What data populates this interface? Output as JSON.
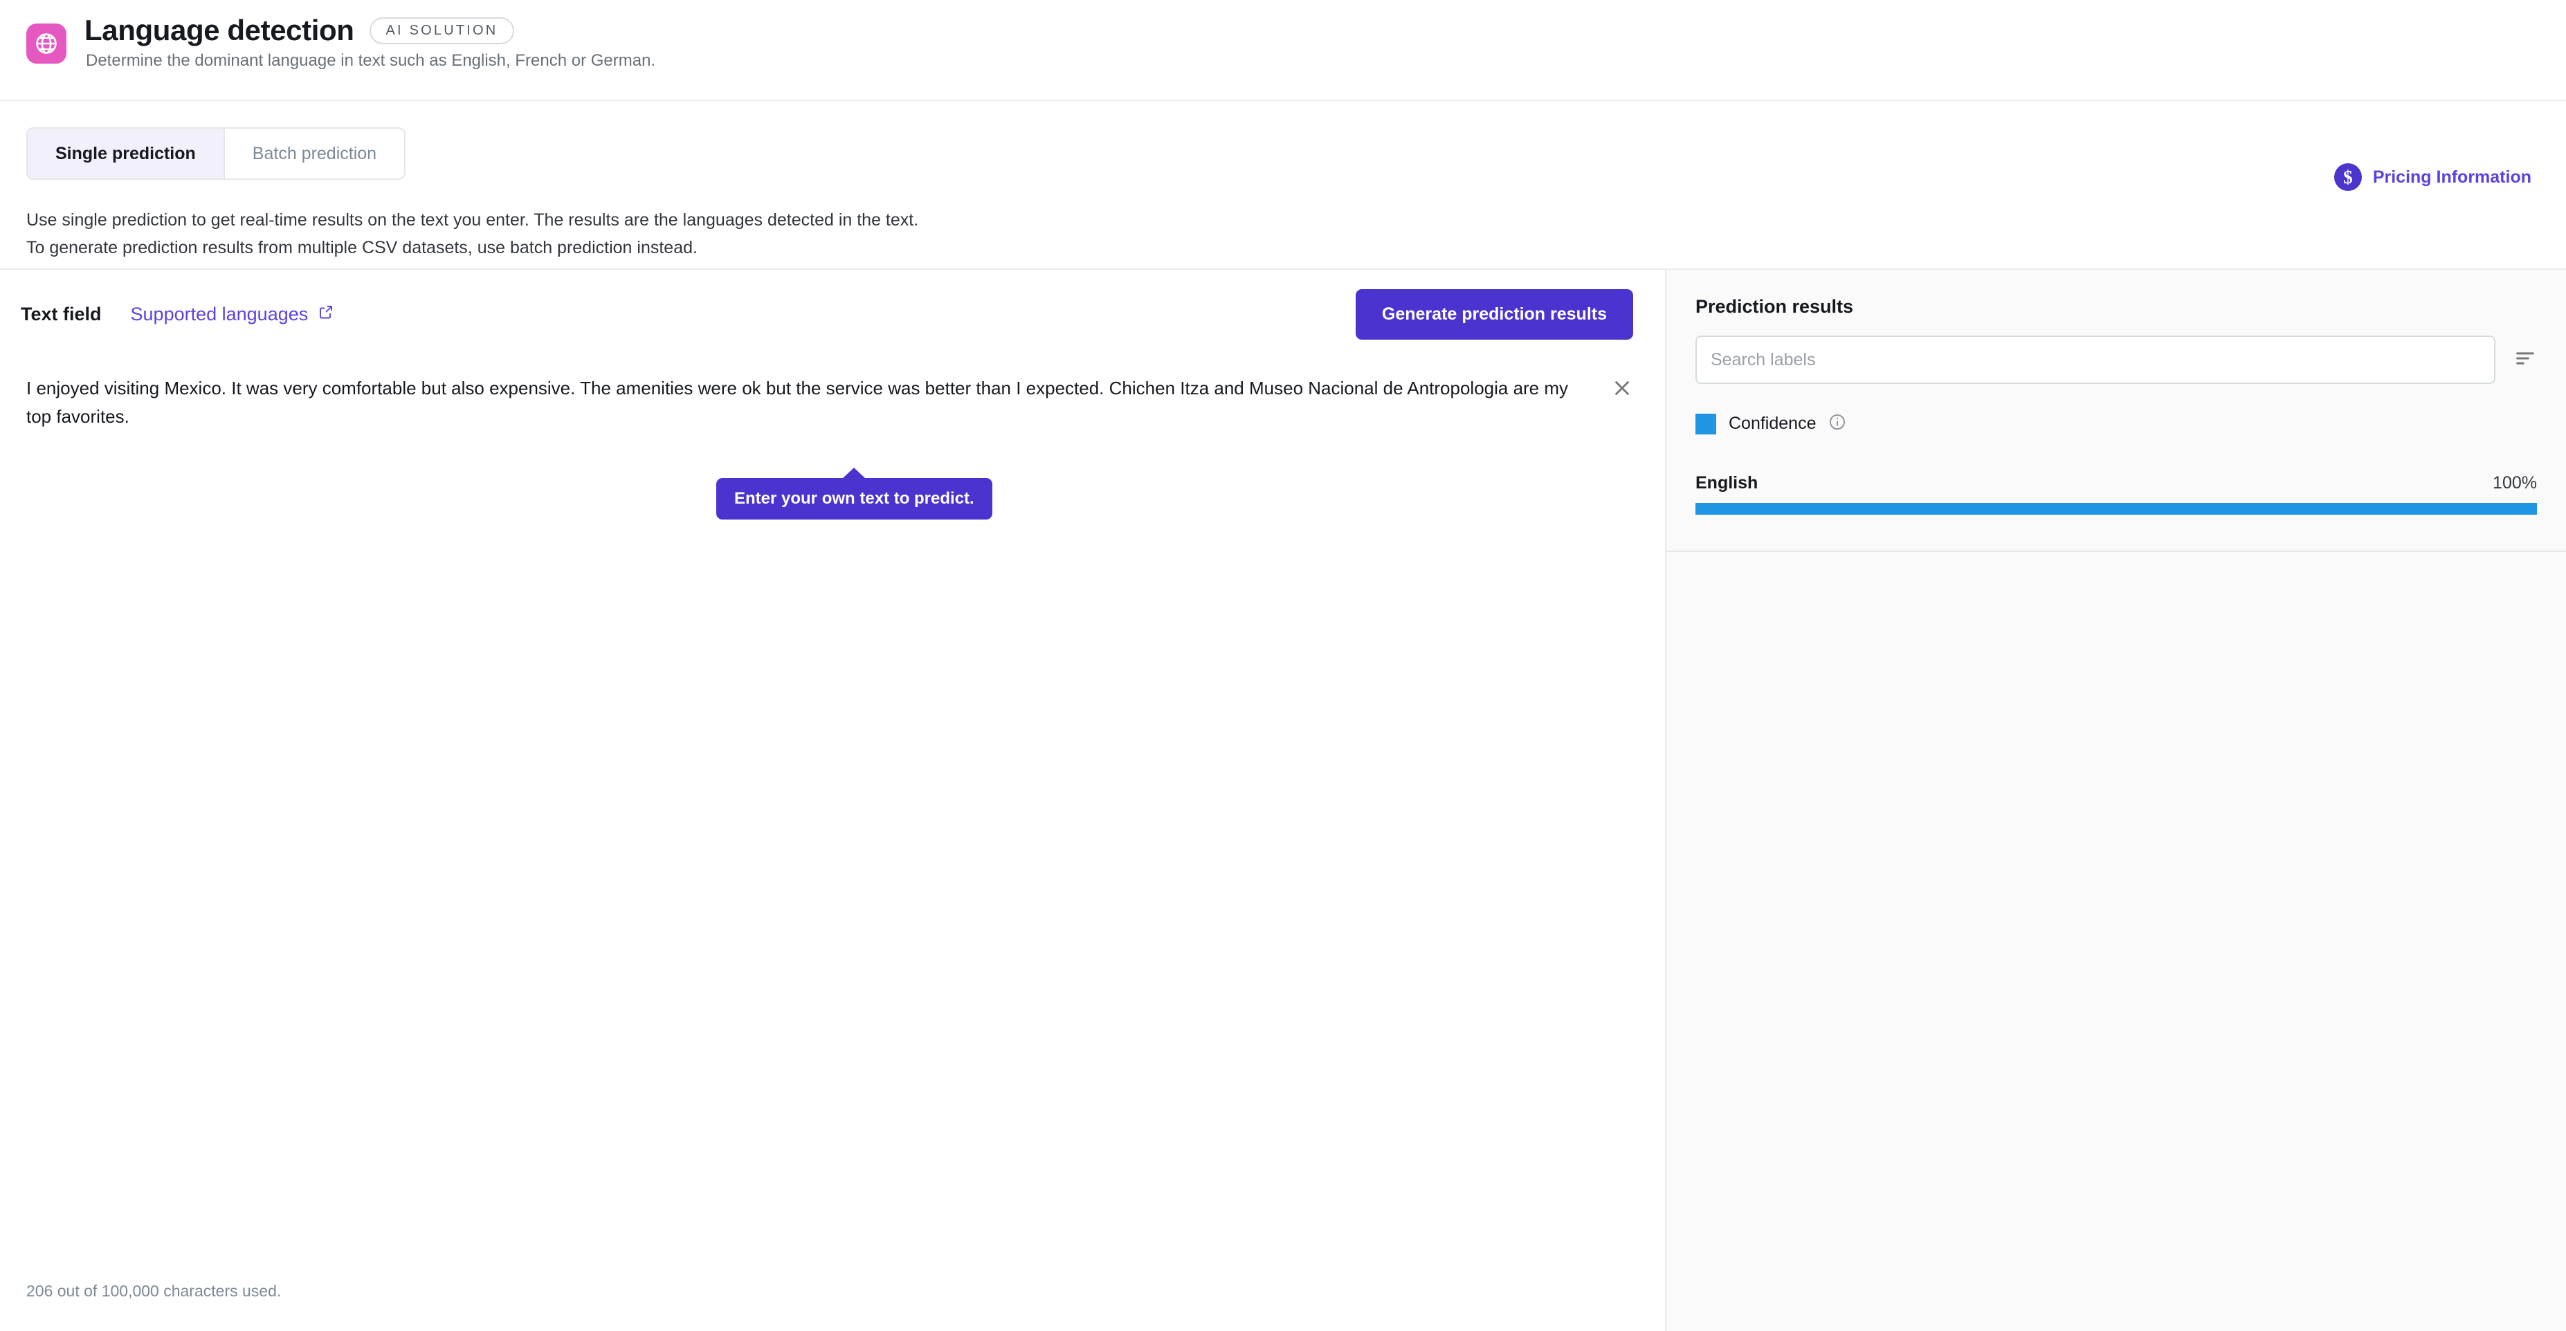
{
  "header": {
    "icon": "globe-icon",
    "icon_bg": "#e558c0",
    "title": "Language detection",
    "badge": "AI SOLUTION",
    "subtitle": "Determine the dominant language in text such as English, French or German."
  },
  "tabs": [
    {
      "label": "Single prediction",
      "active": true
    },
    {
      "label": "Batch prediction",
      "active": false
    }
  ],
  "intro": {
    "line1": "Use single prediction to get real-time results on the text you enter. The results are the languages detected in the text.",
    "line2": "To generate prediction results from multiple CSV datasets, use batch prediction instead."
  },
  "pricing": {
    "label": "Pricing Information",
    "icon": "dollar-circle-icon",
    "color": "#5b42e0"
  },
  "text_panel": {
    "field_label": "Text field",
    "supported_link": "Supported languages",
    "supported_link_icon": "external-link-icon",
    "generate_button": "Generate prediction results",
    "generate_button_color": "#4a33cf",
    "clear_icon": "close-icon",
    "entered_text": "I enjoyed visiting Mexico. It was very comfortable but also expensive. The amenities were ok but the service was better than I expected. Chichen Itza and Museo Nacional de Antropologia are my top favorites.",
    "tooltip": "Enter your own text to predict.",
    "char_count": "206 out of 100,000 characters used."
  },
  "results": {
    "title": "Prediction results",
    "search_placeholder": "Search labels",
    "search_value": "",
    "sort_icon": "sort-descending-icon",
    "legend": {
      "label": "Confidence",
      "color": "#1f95e3",
      "info_icon": "info-icon"
    },
    "items": [
      {
        "label": "English",
        "value": "100%",
        "percent": 100
      }
    ]
  },
  "chart_data": {
    "type": "bar",
    "categories": [
      "English"
    ],
    "values": [
      100
    ],
    "title": "Prediction results",
    "series": [
      {
        "name": "Confidence",
        "values": [
          100
        ]
      }
    ],
    "xlabel": "",
    "ylabel": "Confidence",
    "ylim": [
      0,
      100
    ],
    "legend": "Confidence",
    "orientation": "horizontal",
    "grid": false
  }
}
